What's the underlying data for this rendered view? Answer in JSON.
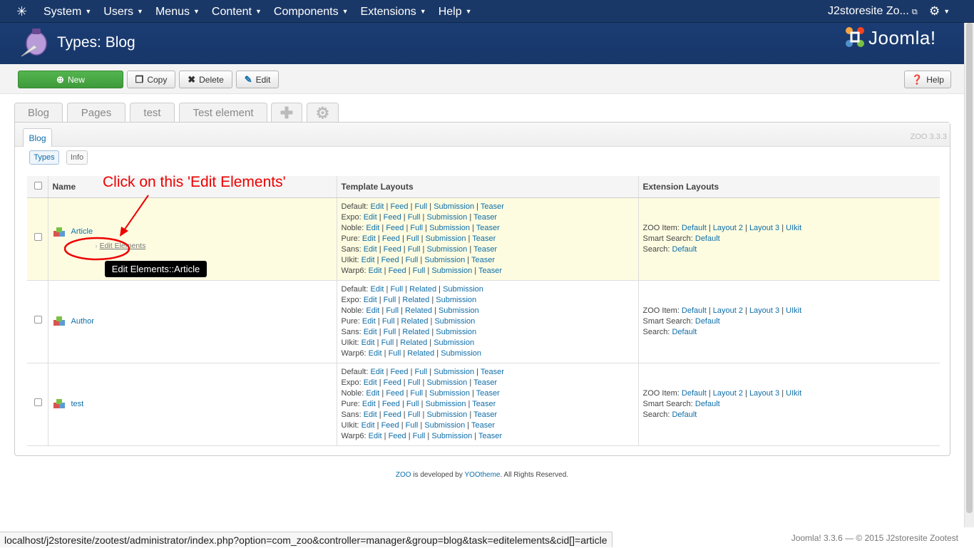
{
  "topnav": {
    "menu": [
      "System",
      "Users",
      "Menus",
      "Content",
      "Components",
      "Extensions",
      "Help"
    ],
    "site_name": "J2storesite Zo...",
    "gear_icon": "gear-icon"
  },
  "header": {
    "title": "Types: Blog",
    "brand": "Joomla!"
  },
  "toolbar": {
    "new": "New",
    "copy": "Copy",
    "delete": "Delete",
    "edit": "Edit",
    "help": "Help"
  },
  "tabs": [
    "Blog",
    "Pages",
    "test",
    "Test element"
  ],
  "panel": {
    "subtab": "Blog",
    "version": "ZOO 3.3.3",
    "pills": [
      "Types",
      "Info"
    ]
  },
  "table": {
    "headers": [
      "Name",
      "Template Layouts",
      "Extension Layouts"
    ],
    "rows": [
      {
        "name": "Article",
        "edit_elements": "Edit Elements",
        "templates": [
          {
            "label": "Default:",
            "links": [
              "Edit",
              "Feed",
              "Full",
              "Submission",
              "Teaser"
            ]
          },
          {
            "label": "Expo:",
            "links": [
              "Edit",
              "Feed",
              "Full",
              "Submission",
              "Teaser"
            ]
          },
          {
            "label": "Noble:",
            "links": [
              "Edit",
              "Feed",
              "Full",
              "Submission",
              "Teaser"
            ]
          },
          {
            "label": "Pure:",
            "links": [
              "Edit",
              "Feed",
              "Full",
              "Submission",
              "Teaser"
            ]
          },
          {
            "label": "Sans:",
            "links": [
              "Edit",
              "Feed",
              "Full",
              "Submission",
              "Teaser"
            ]
          },
          {
            "label": "UIkit:",
            "links": [
              "Edit",
              "Feed",
              "Full",
              "Submission",
              "Teaser"
            ]
          },
          {
            "label": "Warp6:",
            "links": [
              "Edit",
              "Feed",
              "Full",
              "Submission",
              "Teaser"
            ]
          }
        ],
        "extensions": [
          {
            "label": "ZOO Item:",
            "links": [
              "Default",
              "Layout 2",
              "Layout 3",
              "UIkit"
            ]
          },
          {
            "label": "Smart Search:",
            "links": [
              "Default"
            ]
          },
          {
            "label": "Search:",
            "links": [
              "Default"
            ]
          }
        ]
      },
      {
        "name": "Author",
        "templates": [
          {
            "label": "Default:",
            "links": [
              "Edit",
              "Full",
              "Related",
              "Submission"
            ]
          },
          {
            "label": "Expo:",
            "links": [
              "Edit",
              "Full",
              "Related",
              "Submission"
            ]
          },
          {
            "label": "Noble:",
            "links": [
              "Edit",
              "Full",
              "Related",
              "Submission"
            ]
          },
          {
            "label": "Pure:",
            "links": [
              "Edit",
              "Full",
              "Related",
              "Submission"
            ]
          },
          {
            "label": "Sans:",
            "links": [
              "Edit",
              "Full",
              "Related",
              "Submission"
            ]
          },
          {
            "label": "UIkit:",
            "links": [
              "Edit",
              "Full",
              "Related",
              "Submission"
            ]
          },
          {
            "label": "Warp6:",
            "links": [
              "Edit",
              "Full",
              "Related",
              "Submission"
            ]
          }
        ],
        "extensions": [
          {
            "label": "ZOO Item:",
            "links": [
              "Default",
              "Layout 2",
              "Layout 3",
              "UIkit"
            ]
          },
          {
            "label": "Smart Search:",
            "links": [
              "Default"
            ]
          },
          {
            "label": "Search:",
            "links": [
              "Default"
            ]
          }
        ]
      },
      {
        "name": "test",
        "templates": [
          {
            "label": "Default:",
            "links": [
              "Edit",
              "Feed",
              "Full",
              "Submission",
              "Teaser"
            ]
          },
          {
            "label": "Expo:",
            "links": [
              "Edit",
              "Feed",
              "Full",
              "Submission",
              "Teaser"
            ]
          },
          {
            "label": "Noble:",
            "links": [
              "Edit",
              "Feed",
              "Full",
              "Submission",
              "Teaser"
            ]
          },
          {
            "label": "Pure:",
            "links": [
              "Edit",
              "Feed",
              "Full",
              "Submission",
              "Teaser"
            ]
          },
          {
            "label": "Sans:",
            "links": [
              "Edit",
              "Feed",
              "Full",
              "Submission",
              "Teaser"
            ]
          },
          {
            "label": "UIkit:",
            "links": [
              "Edit",
              "Feed",
              "Full",
              "Submission",
              "Teaser"
            ]
          },
          {
            "label": "Warp6:",
            "links": [
              "Edit",
              "Feed",
              "Full",
              "Submission",
              "Teaser"
            ]
          }
        ],
        "extensions": [
          {
            "label": "ZOO Item:",
            "links": [
              "Default",
              "Layout 2",
              "Layout 3",
              "UIkit"
            ]
          },
          {
            "label": "Smart Search:",
            "links": [
              "Default"
            ]
          },
          {
            "label": "Search:",
            "links": [
              "Default"
            ]
          }
        ]
      }
    ]
  },
  "annotation": "Click on this 'Edit Elements'",
  "tooltip": "Edit Elements::Article",
  "footer": {
    "zoo": "ZOO",
    "mid": " is developed by ",
    "yoo": "YOOtheme",
    "end": ". All Rights Reserved."
  },
  "statusbar": "localhost/j2storesite/zootest/administrator/index.php?option=com_zoo&controller=manager&group=blog&task=editelements&cid[]=article",
  "pagefoot": "Joomla! 3.3.6  —  © 2015 J2storesite Zootest"
}
